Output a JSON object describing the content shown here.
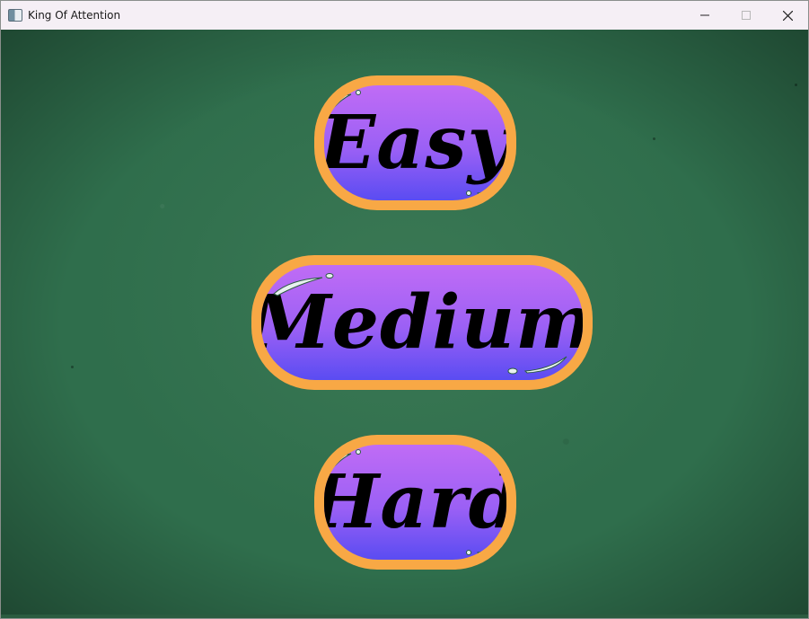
{
  "window": {
    "title": "King Of Attention",
    "icon": "app-window-icon",
    "controls": [
      "minimize-icon",
      "maximize-icon",
      "close-icon"
    ]
  },
  "menu": {
    "buttons": [
      {
        "label": "Easy"
      },
      {
        "label": "Medium"
      },
      {
        "label": "Hard"
      }
    ]
  },
  "colors": {
    "background": "#2f6e4c",
    "button_border": "#f8a845",
    "button_fill_top": "#c06cf5",
    "button_fill_bottom": "#5a4cf2",
    "label": "#000000"
  }
}
